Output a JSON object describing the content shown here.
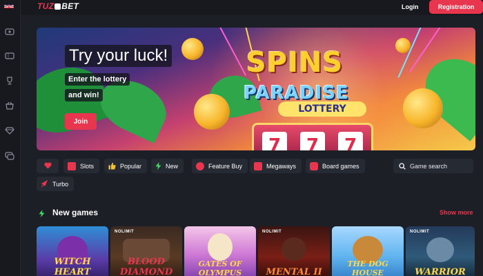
{
  "header": {
    "logo_part1": "TUZ",
    "logo_part2": "BET",
    "login": "Login",
    "register": "Registration"
  },
  "sidebar": {
    "icons": [
      "flag-uk-icon",
      "live-icon",
      "ticket-icon",
      "trophy-icon",
      "basket-icon",
      "diamond-icon",
      "chat-icon"
    ]
  },
  "banner": {
    "title": "Try your luck!",
    "subtitle_line1": "Enter the lottery",
    "subtitle_line2": "and win!",
    "join": "Join",
    "art_word1": "SPINS",
    "art_word2": "PARADISE",
    "art_word3": "LOTTERY",
    "reel_symbol": "7"
  },
  "filters": [
    {
      "label": "",
      "icon": "heart-icon"
    },
    {
      "label": "Slots",
      "icon": "slots-icon"
    },
    {
      "label": "Popular",
      "icon": "thumbs-up-icon"
    },
    {
      "label": "New",
      "icon": "bolt-icon"
    },
    {
      "label": "Feature Buy",
      "icon": "feature-buy-icon"
    },
    {
      "label": "Megaways",
      "icon": "megaways-icon"
    },
    {
      "label": "Board games",
      "icon": "board-games-icon"
    },
    {
      "label": "Turbo",
      "icon": "turbo-icon"
    }
  ],
  "search": {
    "placeholder": "Game search"
  },
  "new_games": {
    "title": "New games",
    "show_more": "Show more",
    "cards": [
      {
        "title": "WITCH HEART",
        "brand": ""
      },
      {
        "title": "BLOOD DIAMOND",
        "brand": "NOLIMIT"
      },
      {
        "title": "GATES OF OLYMPUS",
        "brand": ""
      },
      {
        "title": "MENTAL II",
        "brand": "NOLIMIT"
      },
      {
        "title": "THE DOG HOUSE",
        "brand": ""
      },
      {
        "title": "WARRIOR",
        "brand": "NOLIMIT"
      }
    ]
  },
  "colors": {
    "accent": "#e9364f",
    "background": "#1c1f26",
    "chip": "#262a33"
  }
}
